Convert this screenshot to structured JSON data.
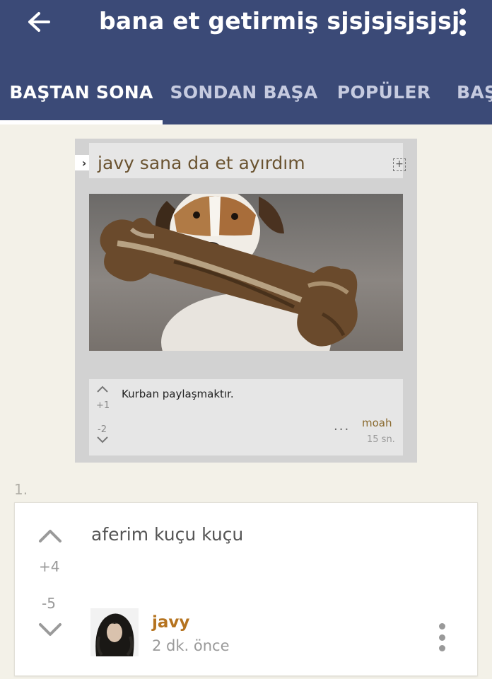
{
  "header": {
    "title": "bana et getirmiş sjsjsjsjsjsj",
    "back_icon": "arrow-left-icon",
    "menu_icon": "more-vertical-icon"
  },
  "tabs": [
    {
      "label": "BAŞTAN SONA",
      "active": true
    },
    {
      "label": "SONDAN BAŞA",
      "active": false
    },
    {
      "label": "POPÜLER",
      "active": false
    },
    {
      "label": "BAŞ",
      "active": false
    }
  ],
  "screenshot": {
    "title": "javy sana da et ayırdım",
    "chevron": "›",
    "expand": "+",
    "image": "dog-with-bone-photo",
    "entry": {
      "text": "Kurban paylaşmaktır.",
      "upvotes": "+1",
      "downvotes": "-2",
      "dots": "...",
      "author": "moah",
      "time": "15 sn."
    }
  },
  "entry": {
    "index": "1.",
    "text": "aferim kuçu kuçu",
    "upvotes": "+4",
    "downvotes": "-5",
    "author": "javy",
    "time": "2 dk. önce"
  },
  "colors": {
    "appbar": "#3b4a77",
    "background": "#f3f1e8",
    "author": "#b5731f"
  }
}
